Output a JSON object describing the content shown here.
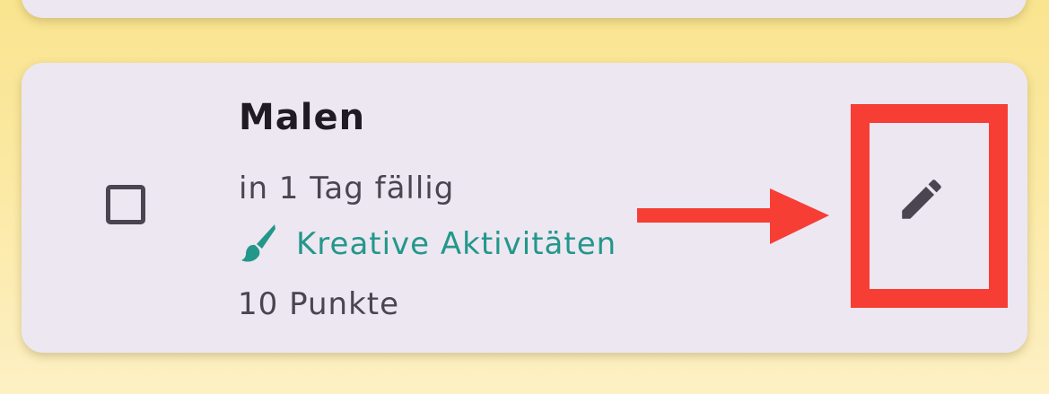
{
  "task": {
    "title": "Malen",
    "due": "in 1 Tag fällig",
    "category": {
      "icon": "paintbrush-icon",
      "label": "Kreative Aktivitäten",
      "color": "#23978a"
    },
    "points": "10 Punkte",
    "completed": false
  },
  "actions": {
    "edit_icon": "edit-pencil-icon"
  },
  "annotation": {
    "color": "#f73e35",
    "target": "edit-button"
  }
}
